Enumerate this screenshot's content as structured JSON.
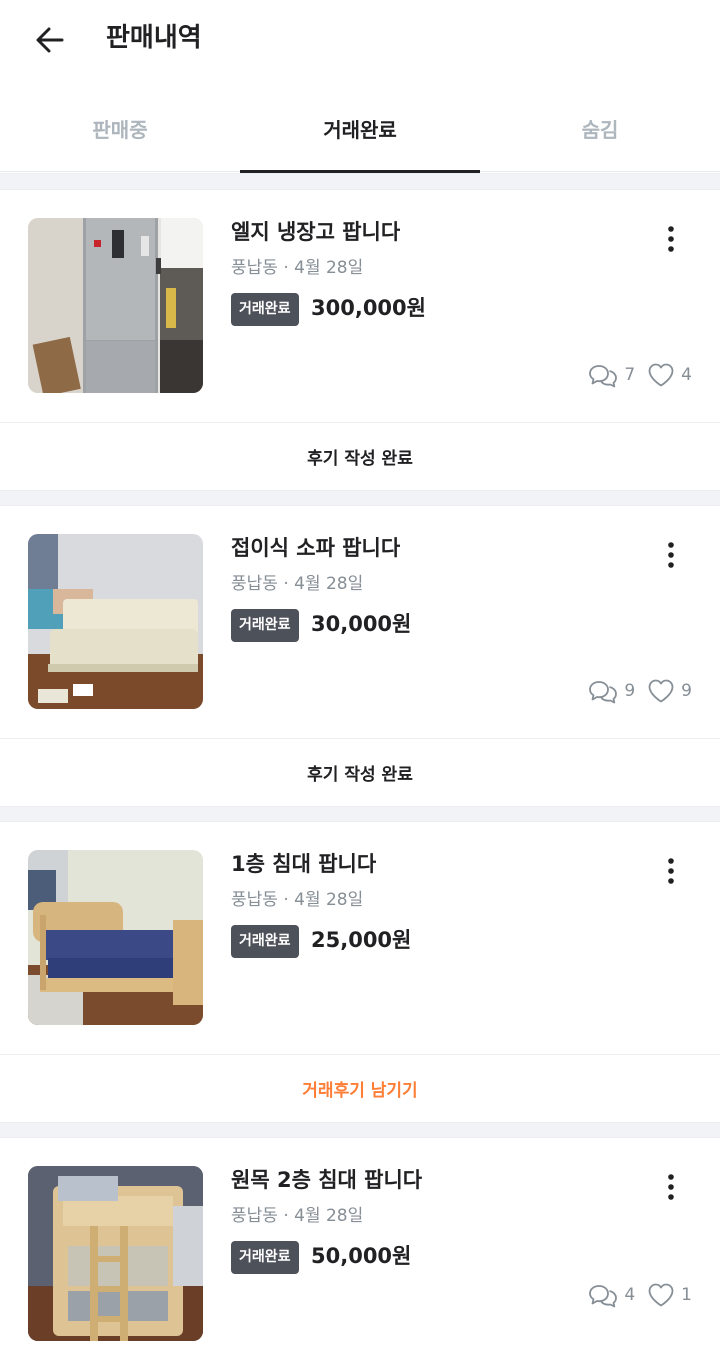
{
  "header": {
    "title": "판매내역"
  },
  "tabs": [
    {
      "label": "판매중",
      "active": false
    },
    {
      "label": "거래완료",
      "active": true
    },
    {
      "label": "숨김",
      "active": false
    }
  ],
  "items": [
    {
      "title": "엘지 냉장고 팝니다",
      "meta": "풍납동 · 4월 28일",
      "badge": "거래완료",
      "price": "300,000원",
      "chats": "7",
      "likes": "4",
      "action": "후기 작성 완료",
      "image": "refrigerator"
    },
    {
      "title": "접이식 소파 팝니다",
      "meta": "풍납동 · 4월 28일",
      "badge": "거래완료",
      "price": "30,000원",
      "chats": "9",
      "likes": "9",
      "action": "후기 작성 완료",
      "image": "sofa"
    },
    {
      "title": "1층 침대 팝니다",
      "meta": "풍납동 · 4월 28일",
      "badge": "거래완료",
      "price": "25,000원",
      "chats": "",
      "likes": "",
      "action": "거래후기 남기기",
      "image": "single-bed"
    },
    {
      "title": "원목 2층 침대 팝니다",
      "meta": "풍납동 · 4월 28일",
      "badge": "거래완료",
      "price": "50,000원",
      "chats": "4",
      "likes": "1",
      "action": "",
      "image": "bunk-bed"
    }
  ],
  "colors": {
    "accent": "#ff7e36",
    "badge_bg": "#4d5159",
    "muted": "#868e96"
  }
}
